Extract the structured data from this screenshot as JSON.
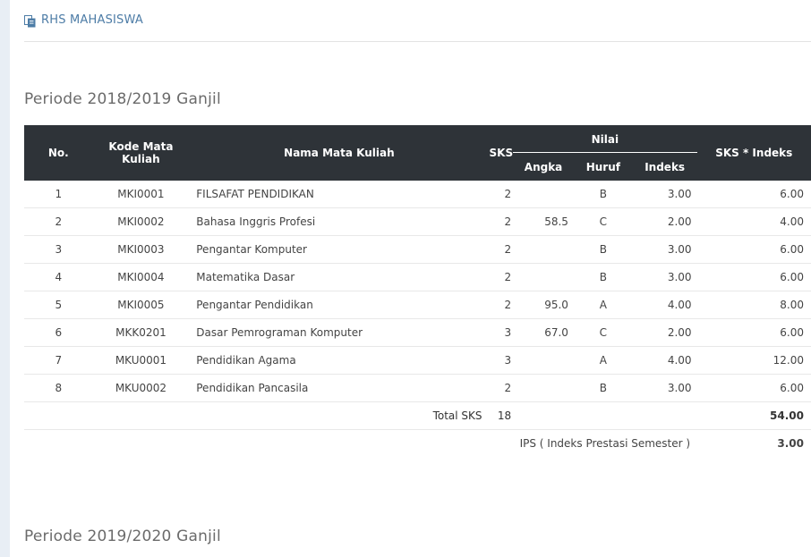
{
  "header": {
    "title": "RHS MAHASISWA",
    "icon": "copy-icon"
  },
  "periods": [
    {
      "label": "Periode 2018/2019 Ganjil"
    },
    {
      "label": "Periode 2019/2020 Ganjil"
    }
  ],
  "table": {
    "headers": {
      "no": "No.",
      "kode": "Kode Mata Kuliah",
      "nama": "Nama Mata Kuliah",
      "sks": "SKS",
      "nilai": "Nilai",
      "angka": "Angka",
      "huruf": "Huruf",
      "indeks": "Indeks",
      "sks_indeks": "SKS * Indeks"
    },
    "rows": [
      {
        "no": "1",
        "kode": "MKI0001",
        "nama": "FILSAFAT PENDIDIKAN",
        "sks": "2",
        "angka": "",
        "huruf": "B",
        "indeks": "3.00",
        "sks_indeks": "6.00"
      },
      {
        "no": "2",
        "kode": "MKI0002",
        "nama": "Bahasa Inggris Profesi",
        "sks": "2",
        "angka": "58.5",
        "huruf": "C",
        "indeks": "2.00",
        "sks_indeks": "4.00"
      },
      {
        "no": "3",
        "kode": "MKI0003",
        "nama": "Pengantar Komputer",
        "sks": "2",
        "angka": "",
        "huruf": "B",
        "indeks": "3.00",
        "sks_indeks": "6.00"
      },
      {
        "no": "4",
        "kode": "MKI0004",
        "nama": "Matematika Dasar",
        "sks": "2",
        "angka": "",
        "huruf": "B",
        "indeks": "3.00",
        "sks_indeks": "6.00"
      },
      {
        "no": "5",
        "kode": "MKI0005",
        "nama": "Pengantar Pendidikan",
        "sks": "2",
        "angka": "95.0",
        "huruf": "A",
        "indeks": "4.00",
        "sks_indeks": "8.00"
      },
      {
        "no": "6",
        "kode": "MKK0201",
        "nama": "Dasar Pemrograman Komputer",
        "sks": "3",
        "angka": "67.0",
        "huruf": "C",
        "indeks": "2.00",
        "sks_indeks": "6.00"
      },
      {
        "no": "7",
        "kode": "MKU0001",
        "nama": "Pendidikan Agama",
        "sks": "3",
        "angka": "",
        "huruf": "A",
        "indeks": "4.00",
        "sks_indeks": "12.00"
      },
      {
        "no": "8",
        "kode": "MKU0002",
        "nama": "Pendidikan Pancasila",
        "sks": "2",
        "angka": "",
        "huruf": "B",
        "indeks": "3.00",
        "sks_indeks": "6.00"
      }
    ],
    "total": {
      "label": "Total SKS",
      "sks": "18",
      "sks_indeks": "54.00"
    },
    "ips": {
      "label": "IPS ( Indeks Prestasi Semester )",
      "value": "3.00"
    }
  }
}
